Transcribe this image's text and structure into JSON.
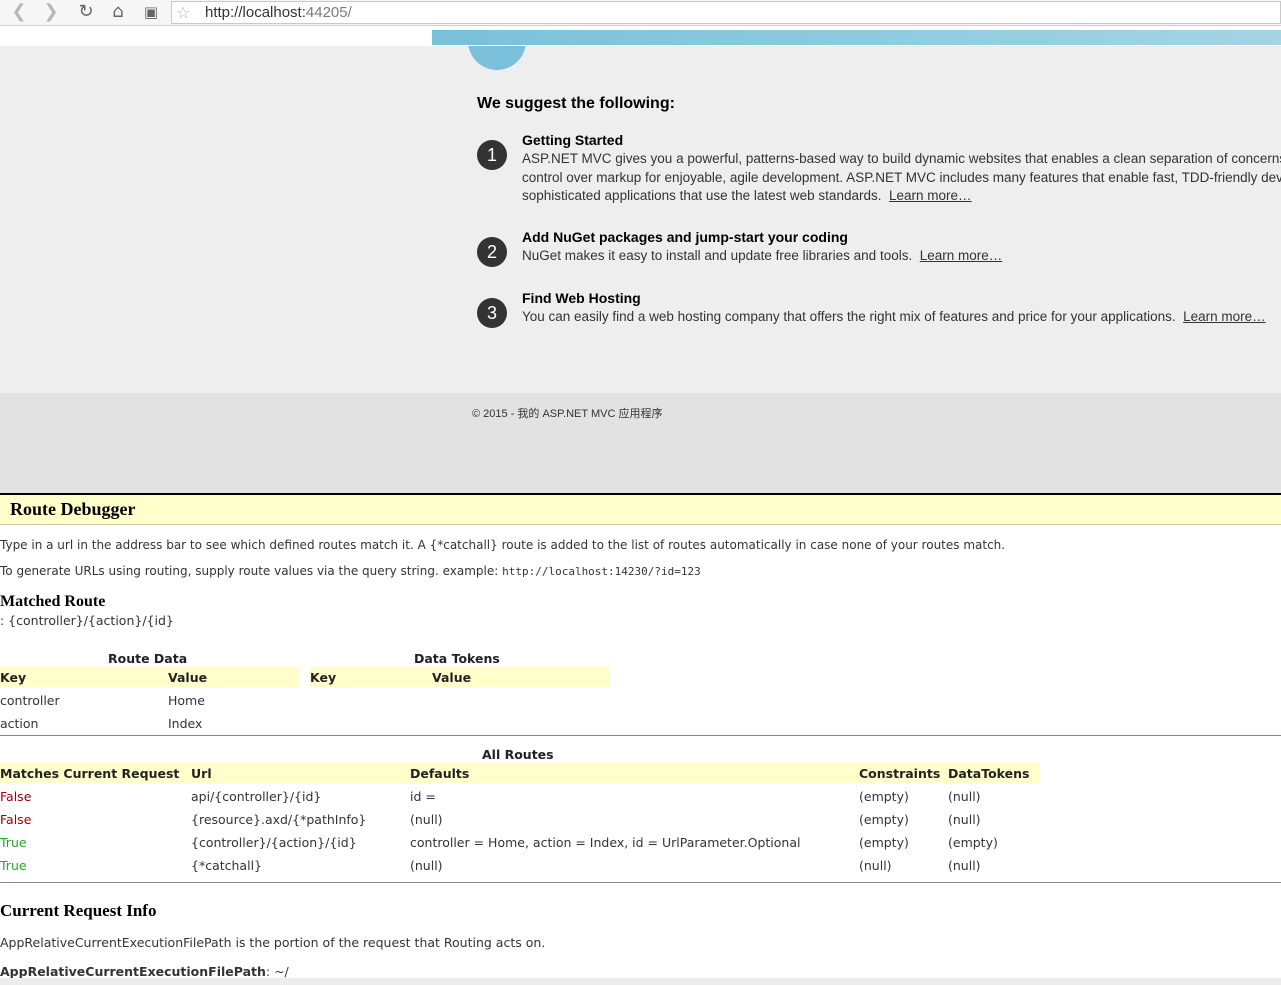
{
  "browser": {
    "url_host": "http://localhost:",
    "url_port": "44205/",
    "back_icon": "back-arrow-icon",
    "forward_icon": "forward-arrow-icon"
  },
  "site": {
    "suggest_heading": "We suggest the following:",
    "steps": [
      {
        "num": "1",
        "title": "Getting Started",
        "lines": [
          "ASP.NET MVC gives you a powerful, patterns-based way to build dynamic websites that enables a clean separation of concerns and gives you full",
          "control over markup for enjoyable, agile development. ASP.NET MVC includes many features that enable fast, TDD-friendly development for creating",
          "sophisticated applications that use the latest web standards."
        ],
        "link": "Learn more…"
      },
      {
        "num": "2",
        "title": "Add NuGet packages and jump-start your coding",
        "lines": [
          "NuGet makes it easy to install and update free libraries and tools."
        ],
        "link": "Learn more…"
      },
      {
        "num": "3",
        "title": "Find Web Hosting",
        "lines": [
          "You can easily find a web hosting company that offers the right mix of features and price for your applications."
        ],
        "link": "Learn more…"
      }
    ],
    "footer": "© 2015 - 我的 ASP.NET MVC 应用程序"
  },
  "debugger": {
    "title": "Route Debugger",
    "intro": "Type in a url in the address bar to see which defined routes match it. A {*catchall} route is added to the list of routes automatically in case none of your routes match.",
    "gen_prefix": "To generate URLs using routing, supply route values via the query string. example: ",
    "gen_example": "http://localhost:14230/?id=123",
    "matched_heading": "Matched Route",
    "matched_value": ": {controller}/{action}/{id}",
    "route_data": {
      "caption": "Route Data",
      "key_header": "Key",
      "value_header": "Value",
      "rows": [
        {
          "key": "controller",
          "value": "Home"
        },
        {
          "key": "action",
          "value": "Index"
        }
      ]
    },
    "data_tokens": {
      "caption": "Data Tokens",
      "key_header": "Key",
      "value_header": "Value"
    },
    "all_routes": {
      "caption": "All Routes",
      "headers": {
        "matches": "Matches Current Request",
        "url": "Url",
        "defaults": "Defaults",
        "constraints": "Constraints",
        "tokens": "DataTokens"
      },
      "rows": [
        {
          "matches": "False",
          "url": "api/{controller}/{id}",
          "defaults": "id =",
          "constraints": "(empty)",
          "tokens": "(null)"
        },
        {
          "matches": "False",
          "url": "{resource}.axd/{*pathInfo}",
          "defaults": "(null)",
          "constraints": "(empty)",
          "tokens": "(null)"
        },
        {
          "matches": "True",
          "url": "{controller}/{action}/{id}",
          "defaults": "controller = Home, action = Index, id = UrlParameter.Optional",
          "constraints": "(empty)",
          "tokens": "(empty)"
        },
        {
          "matches": "True",
          "url": "{*catchall}",
          "defaults": "(null)",
          "constraints": "(null)",
          "tokens": "(null)"
        }
      ]
    },
    "request_info": {
      "heading": "Current Request Info",
      "description": "AppRelativeCurrentExecutionFilePath is the portion of the request that Routing acts on.",
      "label": "AppRelativeCurrentExecutionFilePath",
      "value": ": ~/"
    }
  }
}
